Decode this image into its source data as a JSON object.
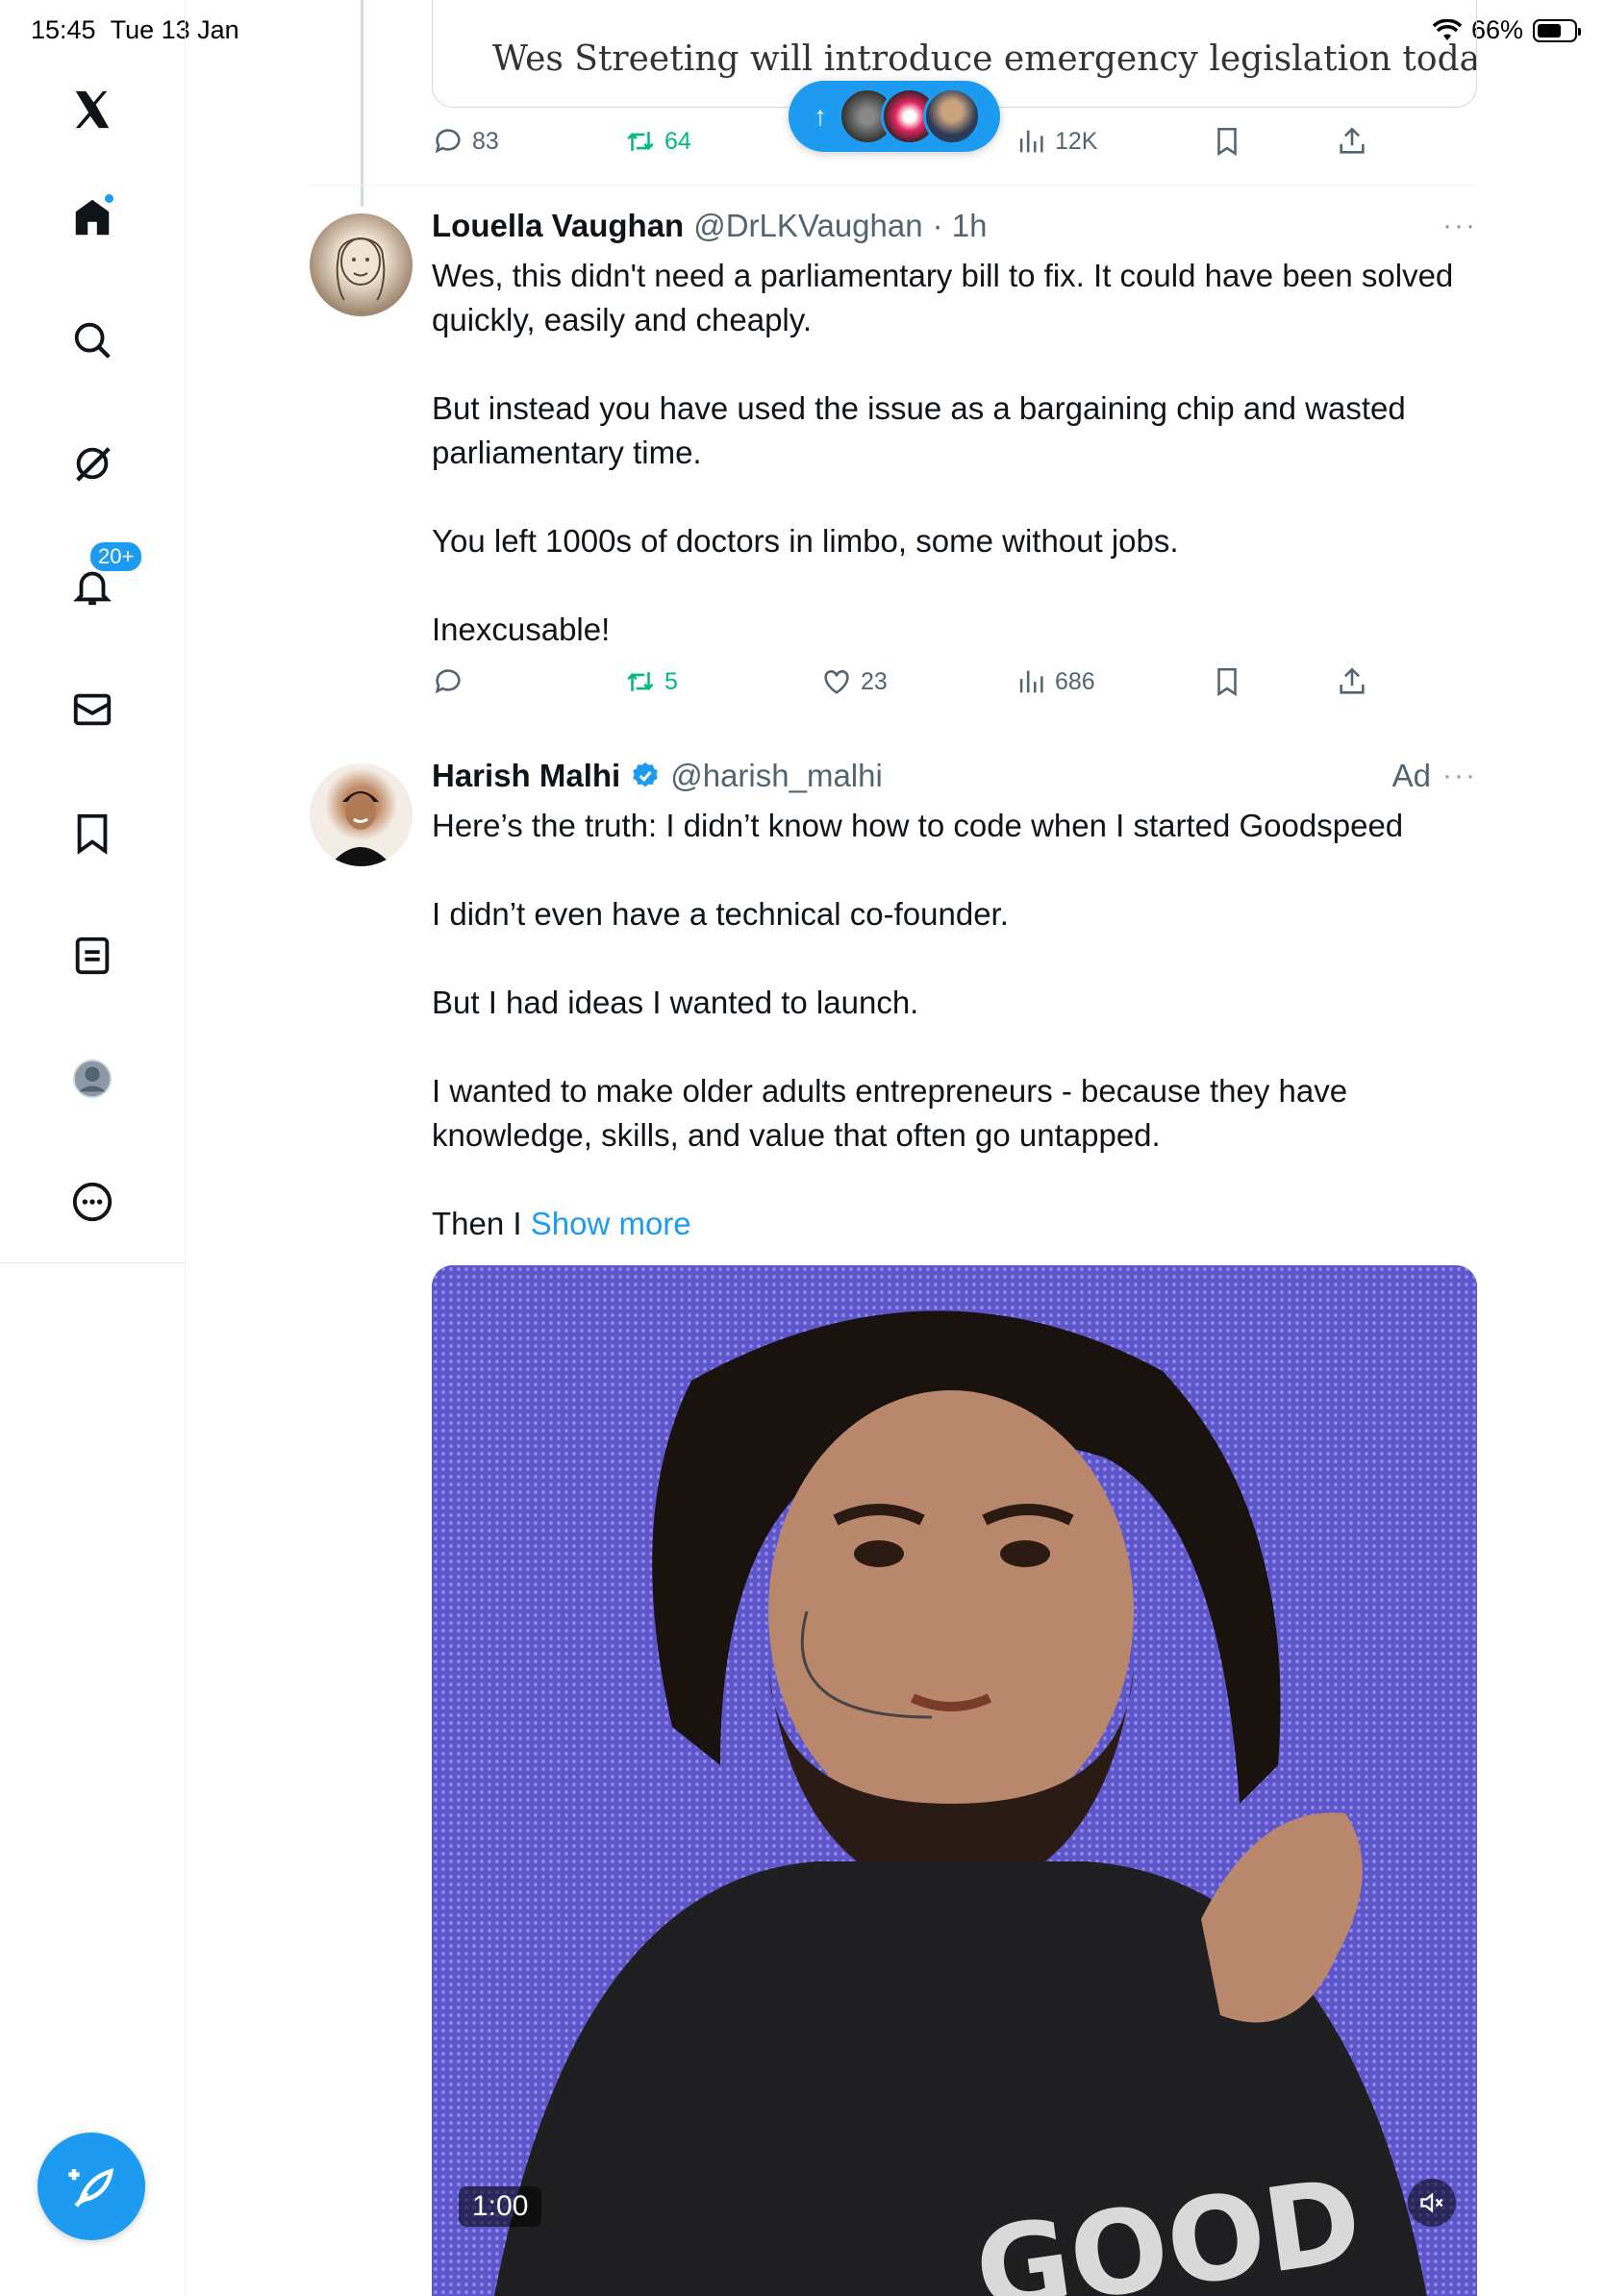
{
  "status_bar": {
    "time": "15:45",
    "date": "Tue 13 Jan",
    "battery": "66%",
    "battery_level": 0.66
  },
  "nav": {
    "items": [
      {
        "name": "home",
        "icon": "home-icon",
        "has_dot": true
      },
      {
        "name": "explore",
        "icon": "search-icon"
      },
      {
        "name": "grok",
        "icon": "grok-icon"
      },
      {
        "name": "notifications",
        "icon": "bell-icon",
        "badge": "20+"
      },
      {
        "name": "messages",
        "icon": "mail-icon"
      },
      {
        "name": "bookmarks",
        "icon": "bookmark-icon"
      },
      {
        "name": "lists",
        "icon": "list-icon"
      },
      {
        "name": "profile",
        "icon": "profile-icon"
      },
      {
        "name": "more",
        "icon": "more-circle-icon"
      }
    ],
    "compose_icon": "compose-feather-icon"
  },
  "new_posts_pill": {
    "icon": "arrow-up-icon"
  },
  "quoted_post": {
    "text": "Wes Streeting will introduce emergency legislation today to",
    "replies": "83",
    "reposts": "64",
    "views": "12K"
  },
  "tweets": [
    {
      "name": "Louella Vaughan",
      "handle": "@DrLKVaughan",
      "time": "· 1h",
      "paragraphs": [
        "Wes, this didn't need a parliamentary bill to fix. It could have been solved quickly, easily and cheaply.",
        "But instead you have used the issue as a bargaining chip and wasted parliamentary time.",
        "You left 1000s of doctors in limbo, some without jobs.",
        "Inexcusable!"
      ],
      "reposts": "5",
      "likes": "23",
      "views": "686"
    },
    {
      "name": "Harish Malhi",
      "handle": "@harish_malhi",
      "ad_label": "Ad",
      "verified": true,
      "paragraphs": [
        "Here’s the truth: I didn’t know how to code when I started Goodspeed",
        "I didn’t even have a technical co-founder.",
        "But I had ideas I wanted to launch.",
        "I wanted to make older adults entrepreneurs - because they have knowledge, skills, and value that often go untapped."
      ],
      "truncated_text": "Then I ",
      "show_more": "Show more",
      "video_duration": "1:00",
      "video_shirt_text": "GOOD"
    }
  ],
  "colors": {
    "accent": "#1d9bf0",
    "repost_green": "#00ba7c",
    "muted_text": "#536471"
  }
}
